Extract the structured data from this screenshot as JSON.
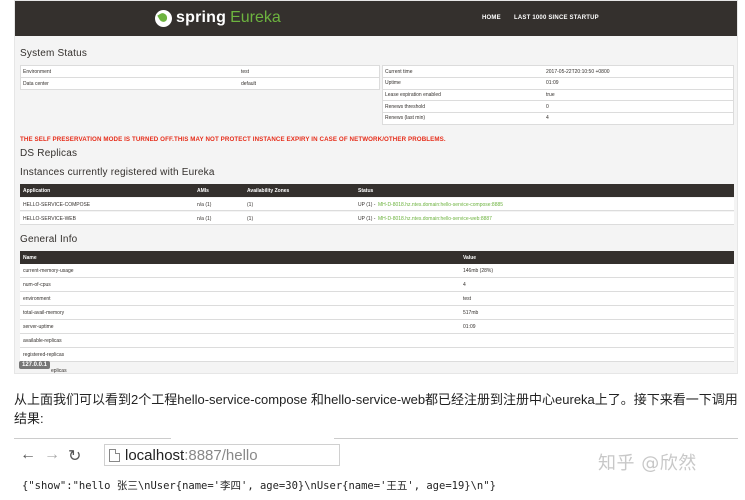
{
  "header": {
    "logo_spring": "spring",
    "logo_eureka": "Eureka",
    "nav_home": "HOME",
    "nav_last1000": "LAST 1000 SINCE STARTUP"
  },
  "system_status": {
    "title": "System Status",
    "left": [
      {
        "label": "Environment",
        "value": "test"
      },
      {
        "label": "Data center",
        "value": "default"
      }
    ],
    "right": [
      {
        "label": "Current time",
        "value": "2017-05-22T20:10:50 +0800"
      },
      {
        "label": "Uptime",
        "value": "01:09"
      },
      {
        "label": "Lease expiration enabled",
        "value": "true"
      },
      {
        "label": "Renews threshold",
        "value": "0"
      },
      {
        "label": "Renews (last min)",
        "value": "4"
      }
    ]
  },
  "warning": "THE SELF PRESERVATION MODE IS TURNED OFF.THIS MAY NOT PROTECT INSTANCE EXPIRY IN CASE OF NETWORK/OTHER PROBLEMS.",
  "ds_replicas_title": "DS Replicas",
  "instances": {
    "title": "Instances currently registered with Eureka",
    "headers": [
      "Application",
      "AMIs",
      "Availability Zones",
      "Status"
    ],
    "rows": [
      {
        "app": "HELLO-SERVICE-COMPOSE",
        "amis": "n/a (1)",
        "zones": "(1)",
        "status": "UP (1) -",
        "link": "MH-D-8018.hz.ntes.domain:hello-service-compose:8885"
      },
      {
        "app": "HELLO-SERVICE-WEB",
        "amis": "n/a (1)",
        "zones": "(1)",
        "status": "UP (1) -",
        "link": "MH-D-8018.hz.ntes.domain:hello-service-web:8887"
      }
    ]
  },
  "general_info": {
    "title": "General Info",
    "headers": [
      "Name",
      "Value"
    ],
    "rows": [
      {
        "name": "current-memory-usage",
        "value": "146mb (28%)"
      },
      {
        "name": "num-of-cpus",
        "value": "4"
      },
      {
        "name": "environment",
        "value": "test"
      },
      {
        "name": "total-avail-memory",
        "value": "517mb"
      },
      {
        "name": "server-uptime",
        "value": "01:09"
      },
      {
        "name": "available-replicas",
        "value": ""
      },
      {
        "name": "registered-replicas",
        "value": ""
      }
    ]
  },
  "ip_badge": "127.0.0.1",
  "ip_badge_suffix": "eplicas",
  "paragraph": "从上面我们可以看到2个工程hello-service-compose 和hello-service-web都已经注册到注册中心eureka上了。接下来看一下调用结果:",
  "browser": {
    "url_host": "localhost",
    "url_port_path": ":8887/hello",
    "back_icon": "back-arrow-icon",
    "forward_icon": "forward-arrow-icon",
    "reload_icon": "reload-icon"
  },
  "watermark": "知乎 @欣然",
  "response": "{\"show\":\"hello 张三\\nUser{name='李四', age=30}\\nUser{name='王五', age=19}\\n\"}"
}
